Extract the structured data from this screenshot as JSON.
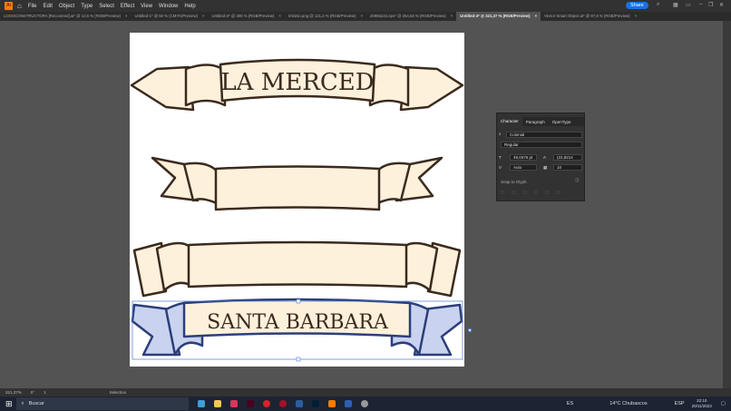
{
  "menu": {
    "items": [
      "File",
      "Edit",
      "Object",
      "Type",
      "Select",
      "Effect",
      "View",
      "Window",
      "Help"
    ],
    "share": "Share"
  },
  "tabs": [
    {
      "label": "LOGOCONSTRUCTORA [Recovered].ai* @ 12,5 % (RGB/Preview)"
    },
    {
      "label": "Untitled-1* @ 50 % (CMYK/Preview)"
    },
    {
      "label": "Untitled-3* @ 300 % (RGB/Preview)"
    },
    {
      "label": "Imlonio.png @ 121,2 % (RGB/Preview)"
    },
    {
      "label": "20965222.eps* @ 254,63 % (RGB/Preview)"
    },
    {
      "label": "Untitled-4* @ 321,37 % (RGB/Preview)"
    },
    {
      "label": "Vector Smart Object.ai* @ 87,8 % (RGB/Preview)"
    }
  ],
  "artboard": {
    "banner1": "LA MERCED",
    "banner4": "SANTA BARBARA"
  },
  "panel": {
    "tabs": [
      "Character",
      "Paragraph",
      "OpenType"
    ],
    "font": "Colonial",
    "style": "Regular",
    "size": "49,0376 pt",
    "leading": "(22,8214",
    "kerning": "Auto",
    "tracking": "10",
    "snap": "Snap to Glyph"
  },
  "status": {
    "zoom": "321,37%",
    "rotate": "0°",
    "artboard": "1",
    "tool": "Selection"
  },
  "taskbar": {
    "search": "Buscar",
    "lang": "ES",
    "weather": "14°C  Chubascos",
    "kbd": "ESP",
    "time": "22:10",
    "date": "20/11/2023"
  }
}
